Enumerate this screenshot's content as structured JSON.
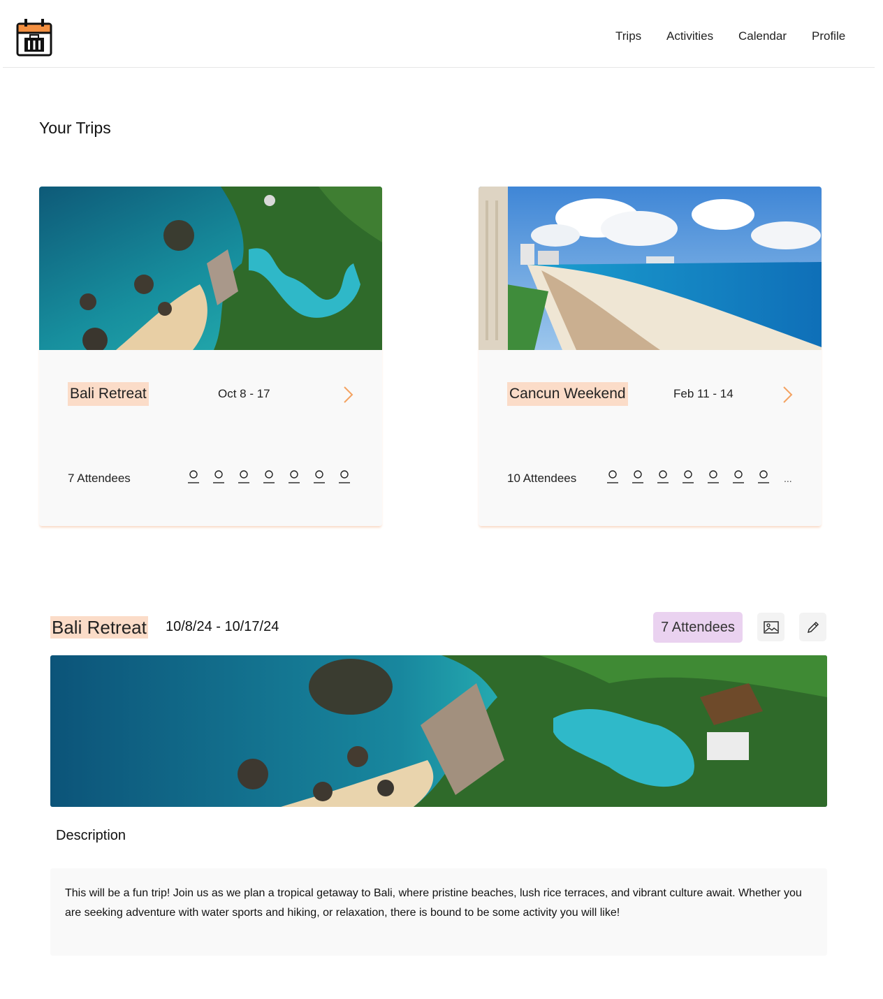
{
  "nav": {
    "items": [
      {
        "label": "Trips"
      },
      {
        "label": "Activities"
      },
      {
        "label": "Calendar"
      },
      {
        "label": "Profile"
      }
    ]
  },
  "page_title": "Your Trips",
  "trips": [
    {
      "name": "Bali Retreat",
      "dates": "Oct 8 - 17",
      "attendees_label": "7 Attendees",
      "avatar_count": 7,
      "more": "",
      "image": "tropical-cliff-pool-beach"
    },
    {
      "name": "Cancun Weekend",
      "dates": "Feb 11 - 14",
      "attendees_label": "10 Attendees",
      "avatar_count": 7,
      "more": "...",
      "image": "hotel-beach-coastline"
    }
  ],
  "detail": {
    "name": "Bali Retreat",
    "dates": "10/8/24 - 10/17/24",
    "attendees_badge": "7 Attendees",
    "image_icon": "image-icon",
    "edit_icon": "pencil-icon",
    "description_label": "Description",
    "description": "This will be a fun trip! Join us as we plan a tropical getaway to Bali, where pristine beaches, lush rice terraces, and vibrant culture await. Whether you are seeking adventure with water sports and hiking, or relaxation, there is bound to be some activity you will like!"
  },
  "colors": {
    "accent_orange": "#f4a261",
    "name_highlight": "#fbdcc8",
    "badge_purple": "#ead2f0",
    "card_bg": "#f9f9f9"
  }
}
